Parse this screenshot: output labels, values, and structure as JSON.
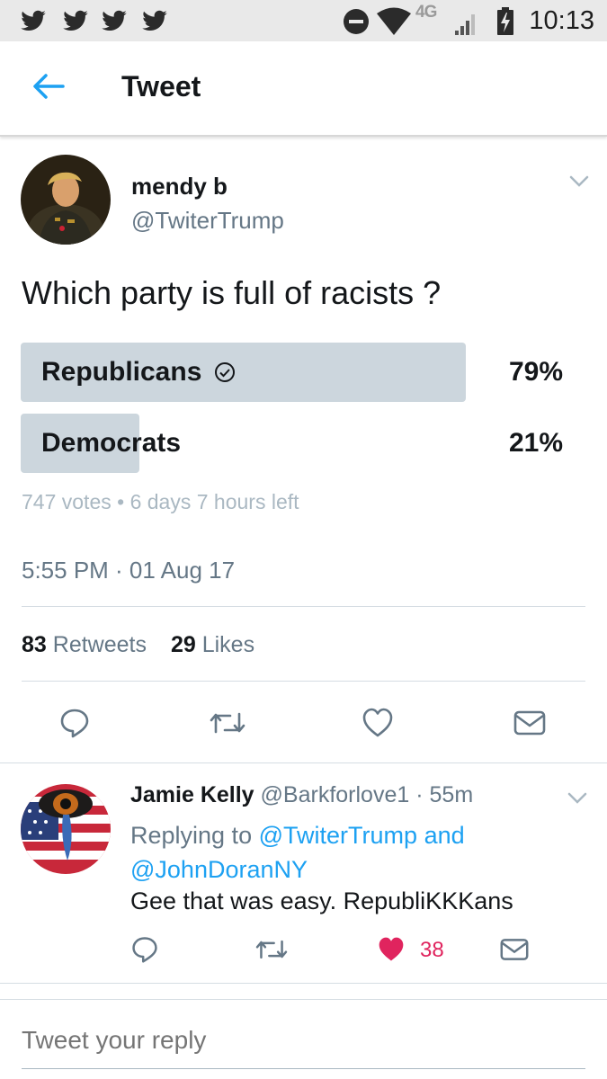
{
  "status_bar": {
    "time": "10:13",
    "network": "4G",
    "notification_icons": [
      "twitter-bird-icon",
      "twitter-bird-icon",
      "twitter-bird-icon",
      "twitter-bird-icon"
    ]
  },
  "app_bar": {
    "title": "Tweet",
    "accent_color": "#1da1f2"
  },
  "tweet": {
    "display_name": "mendy b",
    "handle": "@TwiterTrump",
    "text": "Which party is full of racists ?",
    "poll": {
      "options": [
        {
          "label": "Republicans",
          "percent_text": "79%",
          "percent": 79,
          "selected": true
        },
        {
          "label": "Democrats",
          "percent_text": "21%",
          "percent": 21,
          "selected": false
        }
      ],
      "meta": "747 votes • 6 days 7 hours left"
    },
    "timestamp": "5:55 PM · 01 Aug 17",
    "retweets_count": "83",
    "retweets_label": "Retweets",
    "likes_count": "29",
    "likes_label": "Likes"
  },
  "reply": {
    "display_name": "Jamie Kelly",
    "handle": "@Barkforlove1",
    "time": "· 55m",
    "replying_prefix": "Replying to",
    "replying_user1": "@TwiterTrump",
    "replying_and": "and",
    "replying_user2": "@JohnDoranNY",
    "text": "Gee that was easy. RepubliKKKans",
    "like_count": "38",
    "like_color": "#e0245e"
  },
  "compose": {
    "placeholder": "Tweet your reply"
  }
}
